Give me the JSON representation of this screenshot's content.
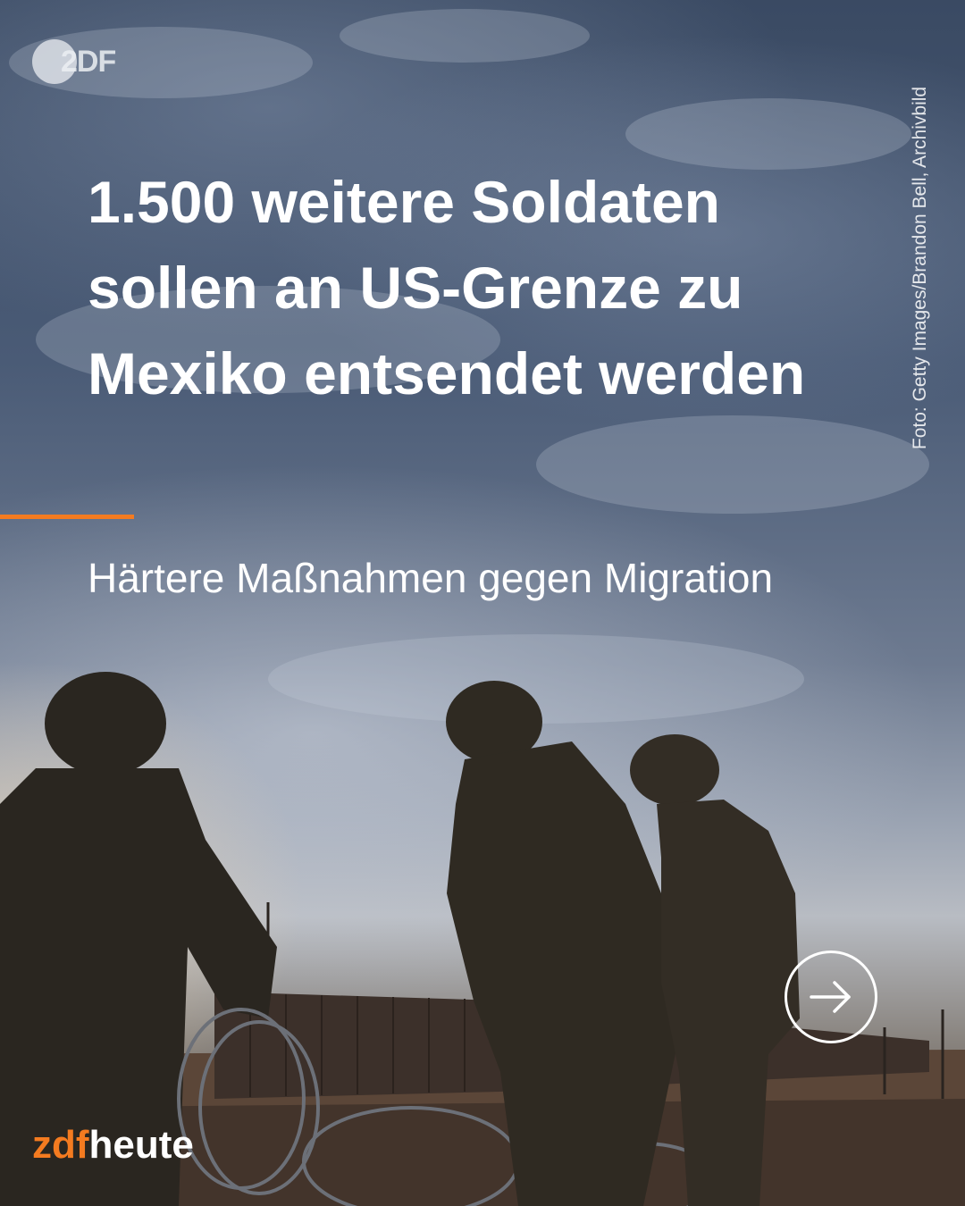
{
  "post": {
    "headline": "1.500 weitere Soldaten sollen an US-Grenze zu Mexiko entsendet werden",
    "subline": "Härtere Maßnahmen gegen Migration",
    "photo_credit": "Foto: Getty Images/Brandon Bell, Archivbild"
  },
  "logos": {
    "zdf": "2DF",
    "brand_zdf": "zdf",
    "brand_heute": "heute"
  },
  "icons": {
    "next": "arrow-right-circle-icon"
  },
  "colors": {
    "accent": "#f47b20",
    "text": "#ffffff"
  }
}
